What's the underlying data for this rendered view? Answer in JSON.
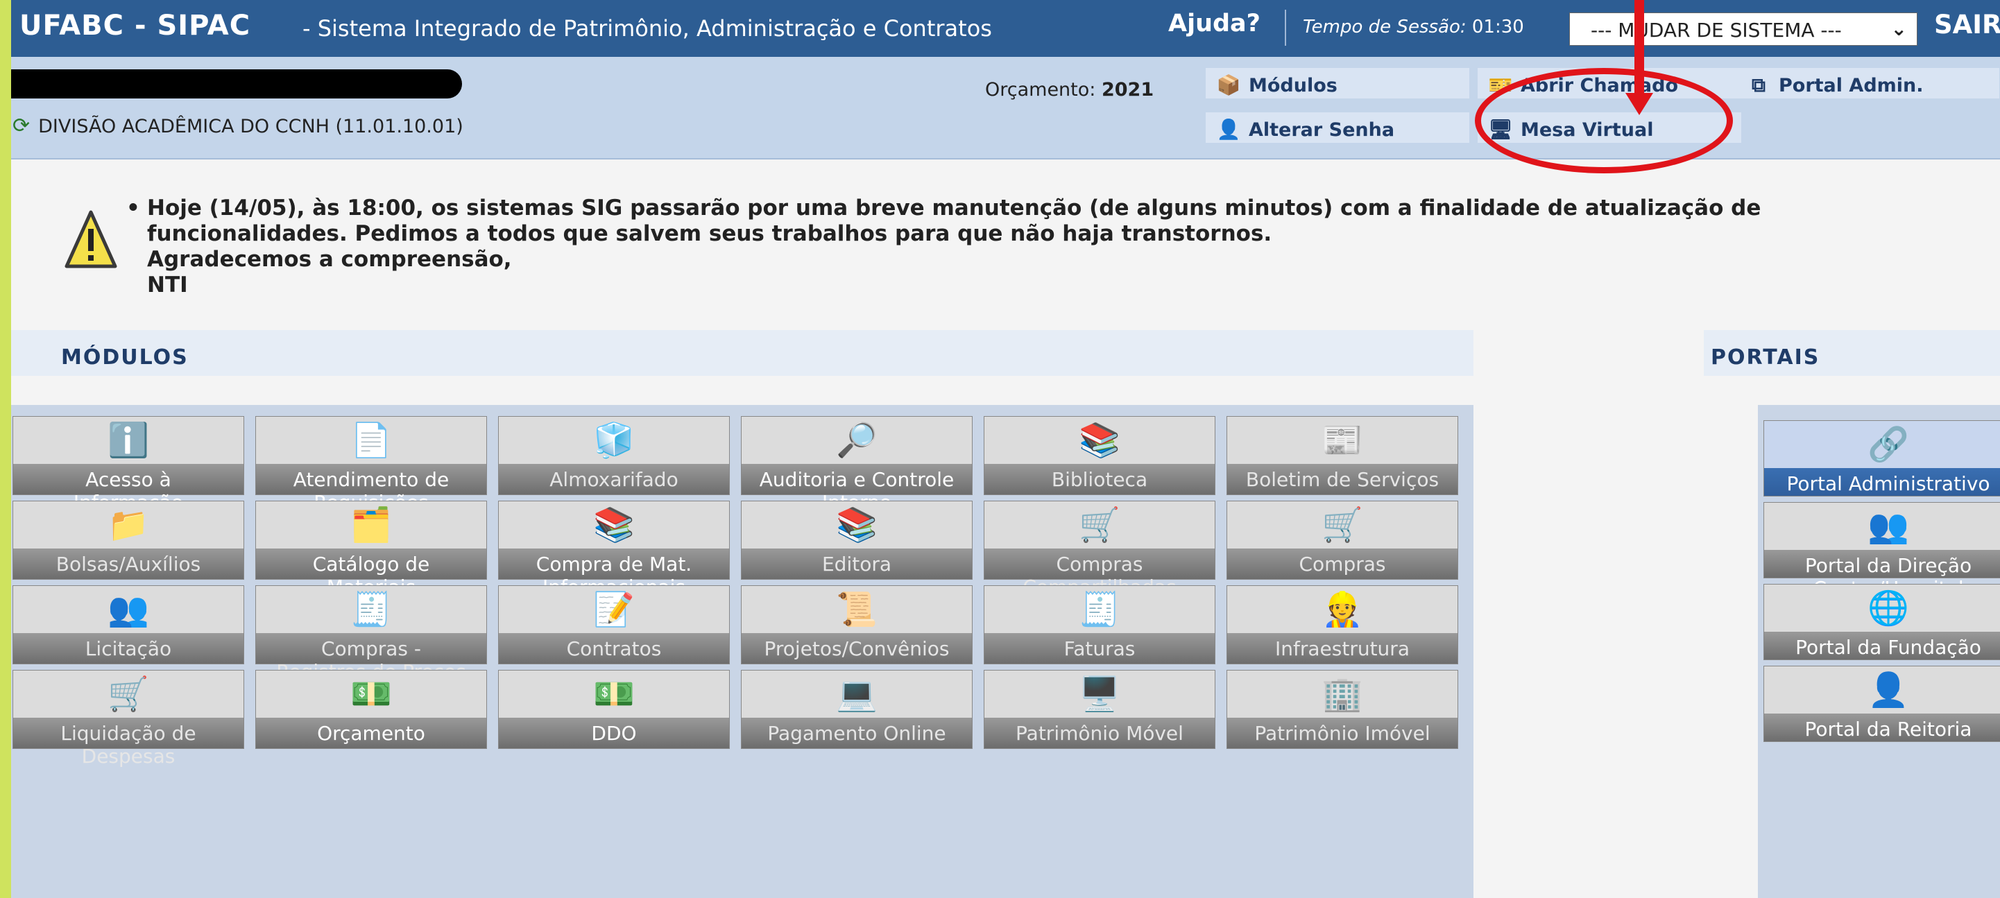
{
  "header": {
    "app_name": "UFABC - SIPAC",
    "system_name": "- Sistema Integrado de Patrimônio, Administração e Contratos",
    "help_label": "Ajuda?",
    "session_label": "Tempo de Sessão:",
    "session_time": "01:30",
    "system_select": "--- MUDAR DE SISTEMA ---",
    "logout_label": "SAIR"
  },
  "info": {
    "unit": "DIVISÃO ACADÊMICA DO CCNH (11.01.10.01)",
    "budget_label": "Orçamento:",
    "budget_year": "2021",
    "links": {
      "modulos": "Módulos",
      "abrir_chamado": "Abrir Chamado",
      "portal_admin": "Portal Admin.",
      "alterar_senha": "Alterar Senha",
      "mesa_virtual": "Mesa Virtual"
    }
  },
  "notice": {
    "line1": "Hoje (14/05), às 18:00, os sistemas SIG passarão por uma breve manutenção (de alguns minutos) com a finalidade de atualização de",
    "line2": "funcionalidades. Pedimos a todos que salvem seus trabalhos para que não haja transtornos.",
    "line3": "Agradecemos a compreensão,",
    "line4": "NTI"
  },
  "sections": {
    "modules_title": "MÓDULOS",
    "portals_title": "PORTAIS"
  },
  "modules": [
    {
      "l1": "Acesso à",
      "l2": "Informação",
      "icon": "info-icon"
    },
    {
      "l1": "Atendimento de",
      "l2": "Requisições",
      "icon": "document-check-icon"
    },
    {
      "l1": "Almoxarifado",
      "l2": "",
      "icon": "boxes-icon"
    },
    {
      "l1": "Auditoria e Controle",
      "l2": "Interno",
      "icon": "user-search-icon"
    },
    {
      "l1": "Biblioteca",
      "l2": "",
      "icon": "books-icon"
    },
    {
      "l1": "Boletim de Serviços",
      "l2": "",
      "icon": "bulletin-icon"
    },
    {
      "l1": "Bolsas/Auxílios",
      "l2": "",
      "icon": "folder-icon"
    },
    {
      "l1": "Catálogo de",
      "l2": "Materiais",
      "icon": "catalog-icon"
    },
    {
      "l1": "Compra de Mat.",
      "l2": "Informacionais",
      "icon": "books-cart-icon"
    },
    {
      "l1": "Editora",
      "l2": "",
      "icon": "books-icon"
    },
    {
      "l1": "Compras",
      "l2": "Compartilhadas",
      "icon": "cart-icon"
    },
    {
      "l1": "Compras",
      "l2": "",
      "icon": "cart-icon"
    },
    {
      "l1": "Licitação",
      "l2": "",
      "icon": "users-icon"
    },
    {
      "l1": "Compras -",
      "l2": "Registros de Preços",
      "icon": "cash-register-icon"
    },
    {
      "l1": "Contratos",
      "l2": "",
      "icon": "contract-icon"
    },
    {
      "l1": "Projetos/Convênios",
      "l2": "",
      "icon": "handshake-icon"
    },
    {
      "l1": "Faturas",
      "l2": "",
      "icon": "invoice-icon"
    },
    {
      "l1": "Infraestrutura",
      "l2": "",
      "icon": "worker-icon"
    },
    {
      "l1": "Liquidação de",
      "l2": "Despesas",
      "icon": "cart-icon"
    },
    {
      "l1": "Orçamento",
      "l2": "",
      "icon": "money-icon"
    },
    {
      "l1": "DDO",
      "l2": "",
      "icon": "money-icon"
    },
    {
      "l1": "Pagamento Online",
      "l2": "",
      "icon": "laptop-payment-icon"
    },
    {
      "l1": "Patrimônio Móvel",
      "l2": "",
      "icon": "computer-icon"
    },
    {
      "l1": "Patrimônio Imóvel",
      "l2": "",
      "icon": "building-icon"
    }
  ],
  "portals": [
    {
      "l1": "Portal Administrativo",
      "l2": "",
      "icon": "network-icon"
    },
    {
      "l1": "Portal da Direção",
      "l2": "Centro/Hospital",
      "icon": "users-icon"
    },
    {
      "l1": "Portal da Fundação",
      "l2": "",
      "icon": "globe-icon"
    },
    {
      "l1": "Portal da Reitoria",
      "l2": "",
      "icon": "user-icon"
    }
  ]
}
